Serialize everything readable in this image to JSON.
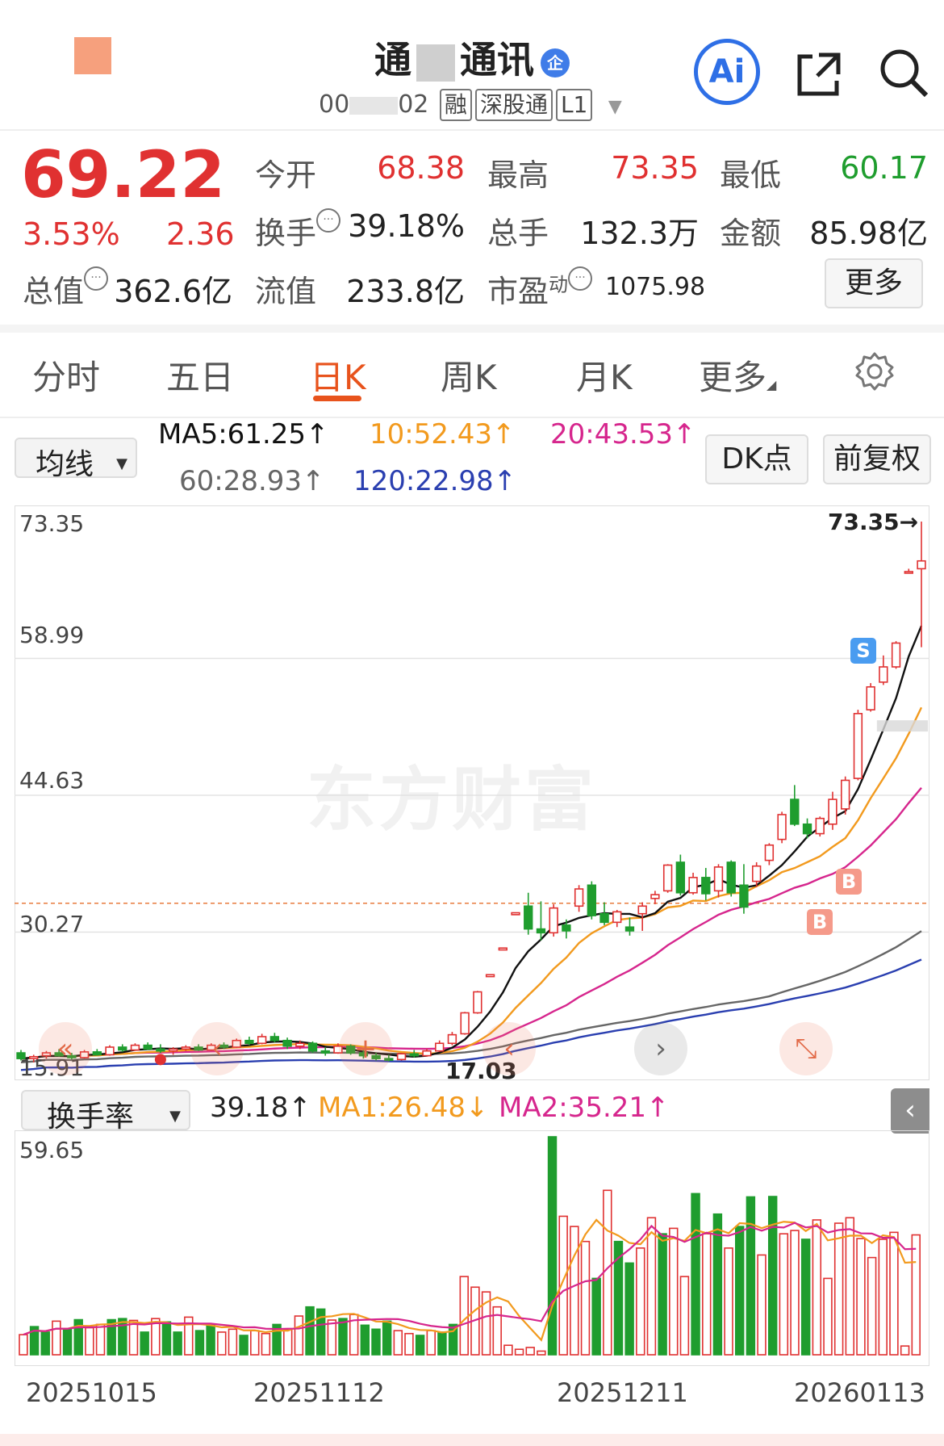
{
  "header": {
    "name_part1": "通",
    "name_part2": "通讯",
    "qi_badge": "企",
    "code_part1": "00",
    "code_part2": "02",
    "tags": [
      "融",
      "深股通",
      "L1"
    ],
    "ai_label": "Ai",
    "icons": [
      "share-icon",
      "search-icon"
    ]
  },
  "quote": {
    "price": "69.22",
    "change_pct": "3.53%",
    "change": "2.36",
    "fields": [
      {
        "label": "今开",
        "value": "68.38",
        "tone": "red"
      },
      {
        "label": "最高",
        "value": "73.35",
        "tone": "red"
      },
      {
        "label": "最低",
        "value": "60.17",
        "tone": "green"
      },
      {
        "label": "换手",
        "value": "39.18%",
        "tone": "normal"
      },
      {
        "label": "总手",
        "value": "132.3万",
        "tone": "normal"
      },
      {
        "label": "金额",
        "value": "85.98亿",
        "tone": "normal"
      },
      {
        "label": "总值",
        "value": "362.6亿",
        "tone": "normal"
      },
      {
        "label": "流值",
        "value": "233.8亿",
        "tone": "normal"
      },
      {
        "label": "市盈",
        "label_sup": "动",
        "value": "1075.98",
        "tone": "normal"
      }
    ],
    "more_button": "更多"
  },
  "tabs": {
    "items": [
      "分时",
      "五日",
      "日K",
      "周K",
      "月K",
      "更多"
    ],
    "active_index": 2
  },
  "indicator": {
    "selector": "均线",
    "ma5": "MA5:61.25↑",
    "ma10": "10:52.43↑",
    "ma20": "20:43.53↑",
    "ma60": "60:28.93↑",
    "ma120": "120:22.98↑",
    "dk_button": "DK点",
    "fq_button": "前复权",
    "colors": {
      "up": "#e03131",
      "down": "#1f9d2e",
      "ma5": "#111111",
      "ma10": "#f29a1e",
      "ma20": "#d6268d",
      "ma60": "#666666",
      "ma120": "#2a3fb0"
    }
  },
  "kline_labels": {
    "y_ticks": [
      "73.35",
      "58.99",
      "44.63",
      "30.27",
      "15.91"
    ],
    "high_tag": "73.35→",
    "low_tag": "17.03",
    "watermark": "东方财富",
    "signal_s": "S",
    "signal_b": "B"
  },
  "volume_panel": {
    "selector": "换手率",
    "value": "39.18↑",
    "ma1": "MA1:26.48↓",
    "ma2": "MA2:35.21↑",
    "y_max_label": "59.65",
    "collapse_label": "‹"
  },
  "x_axis": {
    "labels": [
      "20251015",
      "20251112",
      "20251211",
      "20260113"
    ]
  },
  "chart_data": {
    "type": "candlestick",
    "y_range": [
      15.91,
      73.35
    ],
    "volume_y_max": 59.65,
    "dates_first": "20251015",
    "dates_last": "20260113",
    "candles": [
      {
        "o": 17.6,
        "h": 17.9,
        "l": 16.8,
        "c": 17.0
      },
      {
        "o": 17.0,
        "h": 17.4,
        "l": 16.6,
        "c": 17.2
      },
      {
        "o": 17.3,
        "h": 17.8,
        "l": 17.0,
        "c": 17.6
      },
      {
        "o": 17.6,
        "h": 18.0,
        "l": 17.2,
        "c": 17.3
      },
      {
        "o": 17.3,
        "h": 17.6,
        "l": 16.9,
        "c": 17.1
      },
      {
        "o": 17.1,
        "h": 17.9,
        "l": 17.0,
        "c": 17.7
      },
      {
        "o": 17.7,
        "h": 18.0,
        "l": 17.3,
        "c": 17.4
      },
      {
        "o": 17.4,
        "h": 18.4,
        "l": 17.3,
        "c": 18.2
      },
      {
        "o": 18.2,
        "h": 18.5,
        "l": 17.7,
        "c": 17.9
      },
      {
        "o": 17.9,
        "h": 18.6,
        "l": 17.8,
        "c": 18.4
      },
      {
        "o": 18.4,
        "h": 18.7,
        "l": 17.9,
        "c": 18.0
      },
      {
        "o": 18.0,
        "h": 18.5,
        "l": 17.6,
        "c": 17.8
      },
      {
        "o": 17.8,
        "h": 18.2,
        "l": 17.4,
        "c": 18.0
      },
      {
        "o": 18.0,
        "h": 18.4,
        "l": 17.8,
        "c": 18.2
      },
      {
        "o": 18.2,
        "h": 18.5,
        "l": 17.8,
        "c": 17.9
      },
      {
        "o": 17.9,
        "h": 18.6,
        "l": 17.8,
        "c": 18.4
      },
      {
        "o": 18.4,
        "h": 18.7,
        "l": 18.0,
        "c": 18.2
      },
      {
        "o": 18.2,
        "h": 19.1,
        "l": 18.1,
        "c": 18.9
      },
      {
        "o": 18.9,
        "h": 19.3,
        "l": 18.4,
        "c": 18.6
      },
      {
        "o": 18.6,
        "h": 19.6,
        "l": 18.5,
        "c": 19.3
      },
      {
        "o": 19.3,
        "h": 19.7,
        "l": 18.7,
        "c": 18.9
      },
      {
        "o": 18.9,
        "h": 19.2,
        "l": 18.0,
        "c": 18.3
      },
      {
        "o": 18.3,
        "h": 18.9,
        "l": 18.0,
        "c": 18.6
      },
      {
        "o": 18.6,
        "h": 18.8,
        "l": 17.6,
        "c": 17.8
      },
      {
        "o": 17.8,
        "h": 18.2,
        "l": 17.3,
        "c": 17.6
      },
      {
        "o": 17.6,
        "h": 18.6,
        "l": 17.5,
        "c": 18.3
      },
      {
        "o": 18.3,
        "h": 18.5,
        "l": 17.4,
        "c": 17.6
      },
      {
        "o": 17.6,
        "h": 17.9,
        "l": 17.0,
        "c": 17.3
      },
      {
        "o": 17.3,
        "h": 17.6,
        "l": 16.8,
        "c": 17.0
      },
      {
        "o": 17.0,
        "h": 17.4,
        "l": 16.7,
        "c": 16.9
      },
      {
        "o": 16.9,
        "h": 17.6,
        "l": 16.8,
        "c": 17.5
      },
      {
        "o": 17.5,
        "h": 17.9,
        "l": 17.1,
        "c": 17.3
      },
      {
        "o": 17.3,
        "h": 18.0,
        "l": 17.2,
        "c": 17.8
      },
      {
        "o": 17.8,
        "h": 18.9,
        "l": 17.7,
        "c": 18.6
      },
      {
        "o": 18.6,
        "h": 19.8,
        "l": 18.4,
        "c": 19.5
      },
      {
        "o": 19.6,
        "h": 21.9,
        "l": 19.5,
        "c": 21.8
      },
      {
        "o": 21.8,
        "h": 24.1,
        "l": 21.7,
        "c": 24.0
      },
      {
        "o": 25.6,
        "h": 25.8,
        "l": 25.6,
        "c": 25.8
      },
      {
        "o": 28.4,
        "h": 28.6,
        "l": 28.4,
        "c": 28.6
      },
      {
        "o": 32.1,
        "h": 32.3,
        "l": 32.1,
        "c": 32.3
      },
      {
        "o": 33.0,
        "h": 34.4,
        "l": 30.0,
        "c": 30.6
      },
      {
        "o": 30.6,
        "h": 33.5,
        "l": 29.4,
        "c": 30.2
      },
      {
        "o": 30.2,
        "h": 33.2,
        "l": 29.8,
        "c": 32.8
      },
      {
        "o": 31.0,
        "h": 31.6,
        "l": 29.6,
        "c": 30.4
      },
      {
        "o": 33.0,
        "h": 35.2,
        "l": 32.4,
        "c": 34.8
      },
      {
        "o": 35.2,
        "h": 35.6,
        "l": 31.6,
        "c": 32.0
      },
      {
        "o": 32.2,
        "h": 33.4,
        "l": 31.0,
        "c": 31.3
      },
      {
        "o": 31.3,
        "h": 32.6,
        "l": 30.8,
        "c": 32.4
      },
      {
        "o": 30.8,
        "h": 31.8,
        "l": 29.9,
        "c": 30.4
      },
      {
        "o": 32.2,
        "h": 33.4,
        "l": 30.4,
        "c": 33.0
      },
      {
        "o": 33.8,
        "h": 34.6,
        "l": 33.2,
        "c": 34.2
      },
      {
        "o": 34.6,
        "h": 37.4,
        "l": 34.4,
        "c": 37.3
      },
      {
        "o": 37.6,
        "h": 38.4,
        "l": 34.1,
        "c": 34.4
      },
      {
        "o": 34.4,
        "h": 36.5,
        "l": 34.2,
        "c": 36.0
      },
      {
        "o": 36.0,
        "h": 37.0,
        "l": 33.6,
        "c": 34.3
      },
      {
        "o": 34.6,
        "h": 37.4,
        "l": 33.9,
        "c": 37.1
      },
      {
        "o": 37.6,
        "h": 37.8,
        "l": 34.0,
        "c": 34.4
      },
      {
        "o": 35.2,
        "h": 37.4,
        "l": 32.2,
        "c": 32.9
      },
      {
        "o": 35.6,
        "h": 37.6,
        "l": 35.0,
        "c": 37.2
      },
      {
        "o": 37.8,
        "h": 39.6,
        "l": 37.3,
        "c": 39.4
      },
      {
        "o": 40.0,
        "h": 42.9,
        "l": 39.6,
        "c": 42.6
      },
      {
        "o": 44.2,
        "h": 45.7,
        "l": 41.4,
        "c": 41.6
      },
      {
        "o": 41.6,
        "h": 42.2,
        "l": 40.1,
        "c": 40.6
      },
      {
        "o": 40.6,
        "h": 42.4,
        "l": 40.3,
        "c": 42.2
      },
      {
        "o": 41.6,
        "h": 45.0,
        "l": 41.0,
        "c": 44.2
      },
      {
        "o": 43.2,
        "h": 46.6,
        "l": 42.6,
        "c": 46.2
      },
      {
        "o": 46.4,
        "h": 53.6,
        "l": 46.2,
        "c": 53.2
      },
      {
        "o": 53.6,
        "h": 56.4,
        "l": 53.4,
        "c": 56.0
      },
      {
        "o": 56.5,
        "h": 59.3,
        "l": 56.2,
        "c": 58.1
      },
      {
        "o": 58.1,
        "h": 60.8,
        "l": 57.9,
        "c": 60.6
      },
      {
        "o": 68.1,
        "h": 68.4,
        "l": 67.9,
        "c": 68.1
      },
      {
        "o": 68.4,
        "h": 73.35,
        "l": 60.17,
        "c": 69.22
      }
    ],
    "turnover_bars": [
      5.5,
      7.7,
      6.2,
      9.2,
      7.0,
      9.6,
      7.4,
      8.3,
      9.6,
      9.9,
      9.4,
      6.2,
      9.9,
      9.0,
      6.2,
      10.3,
      6.6,
      8.3,
      6.2,
      7.0,
      5.3,
      6.6,
      5.8,
      8.3,
      7.0,
      10.6,
      13.1,
      12.5,
      9.5,
      9.9,
      11.0,
      8.1,
      7.0,
      9.2,
      6.6,
      5.8,
      5.3,
      6.6,
      6.2,
      8.3,
      21.4,
      18.5,
      17.2,
      13.1,
      2.6,
      1.5,
      2.0,
      1.0,
      59.65,
      37.9,
      35.1,
      31.0,
      20.9,
      45.0,
      31.0,
      25.1,
      29.2,
      37.5,
      33.1,
      34.6,
      21.4,
      44.1,
      33.1,
      38.5,
      29.2,
      35.1,
      43.2,
      27.3,
      43.3,
      33.1,
      34.0,
      31.6,
      36.9,
      20.9,
      36.0,
      37.5,
      31.8,
      26.6,
      31.6,
      33.5,
      2.4,
      32.8
    ],
    "turnover_up": [
      true,
      false,
      false,
      true,
      false,
      false,
      true,
      true,
      false,
      false,
      true,
      false,
      true,
      false,
      false,
      true,
      false,
      false,
      true,
      true,
      false,
      true,
      true,
      false,
      true,
      true,
      false,
      false,
      true,
      false,
      true,
      false,
      false,
      false,
      true,
      true,
      false,
      true,
      false,
      false,
      true,
      true,
      true,
      true,
      true,
      true,
      true,
      true,
      false,
      true,
      true,
      true,
      false,
      true,
      false,
      false,
      true,
      true,
      false,
      true,
      true,
      false,
      true,
      false,
      true,
      false,
      false,
      true,
      false,
      true,
      true,
      false,
      true,
      true,
      true,
      true,
      true,
      true,
      true,
      true,
      true,
      true
    ]
  }
}
